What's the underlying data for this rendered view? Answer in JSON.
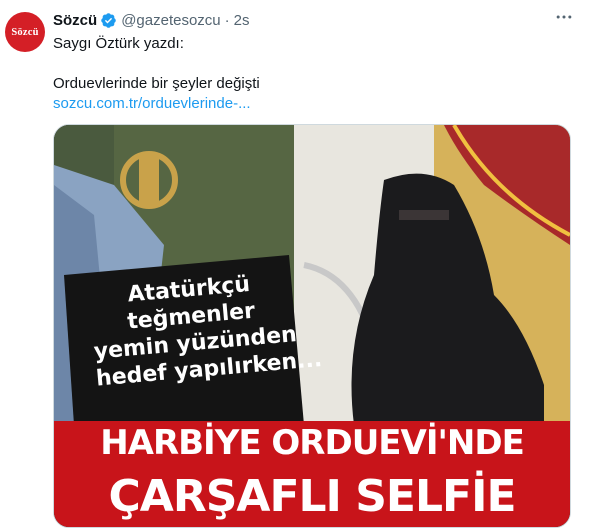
{
  "account": {
    "avatar_text": "Sözcü",
    "name": "Sözcü",
    "handle": "@gazetesozcu",
    "separator": "·",
    "time": "2s"
  },
  "tweet": {
    "line1": "Saygı Öztürk yazdı:",
    "line2": "Orduevlerinde bir şeyler değişti",
    "link": "sozcu.com.tr/orduevlerinde-..."
  },
  "media": {
    "caption_lines": [
      "Atatürkçü",
      "teğmenler",
      "yemin yüzünden",
      "hedef yapılırken..."
    ],
    "headline1": "HARBİYE ORDUEVİ'NDE",
    "headline2": "ÇARŞAFLI SELFİE"
  },
  "icons": {
    "verified": "verified-badge-icon",
    "more": "more-options-icon"
  },
  "colors": {
    "brand": "#d41f26",
    "link": "#1d9bf0",
    "verified": "#1d9bf0",
    "headline_red": "#c8141a"
  }
}
